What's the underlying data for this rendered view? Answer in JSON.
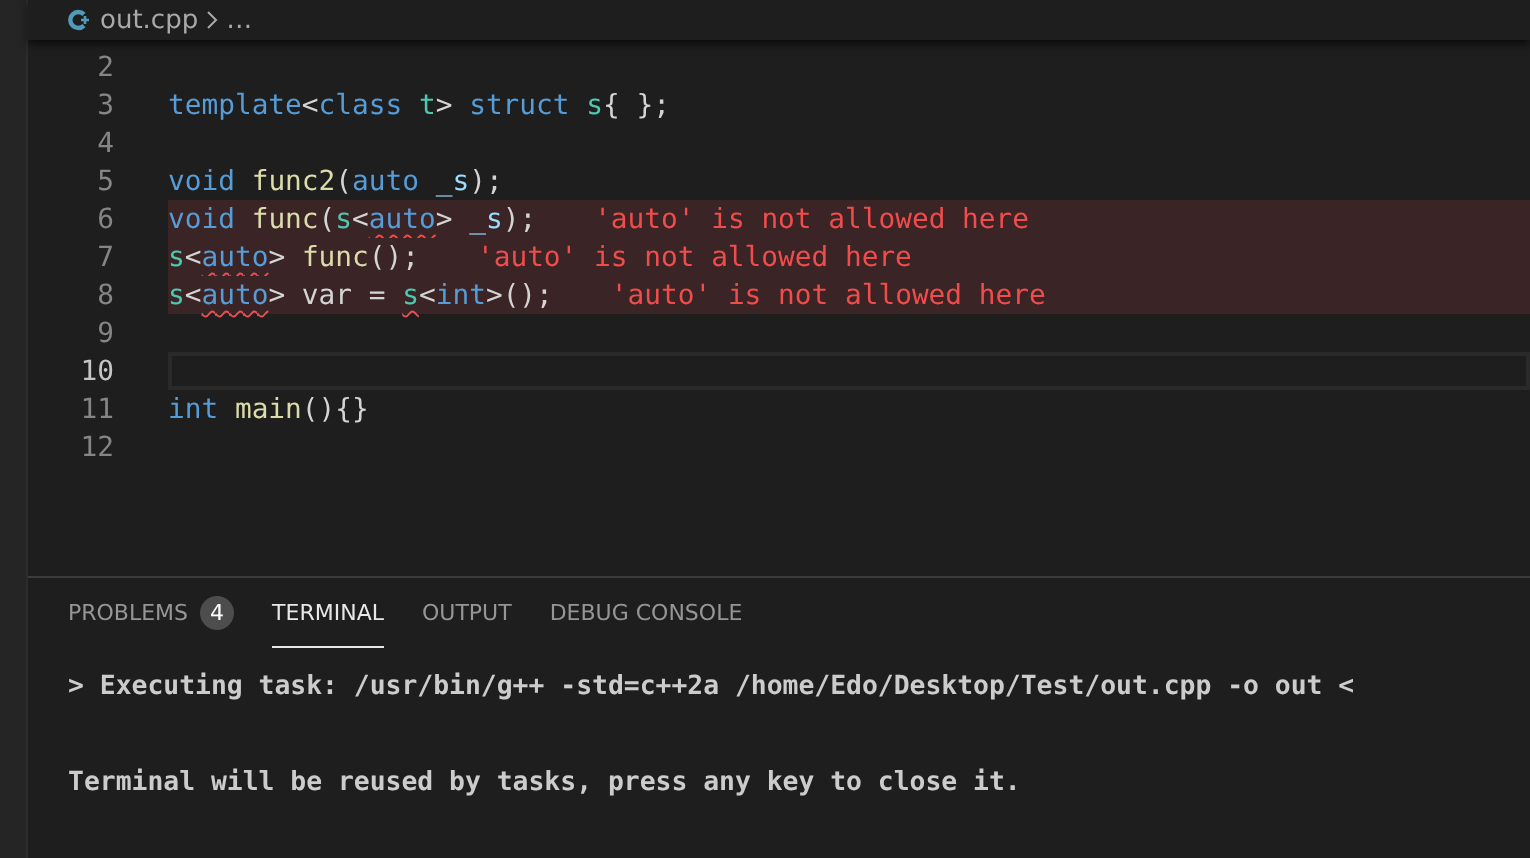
{
  "breadcrumb": {
    "file": "out.cpp",
    "separator": "…"
  },
  "editor": {
    "lines": [
      {
        "number": "2",
        "current": false
      },
      {
        "number": "3",
        "current": false,
        "tokens": [
          {
            "text": "template",
            "kind": "keyword"
          },
          {
            "text": "<",
            "kind": "plain"
          },
          {
            "text": "class ",
            "kind": "keyword"
          },
          {
            "text": "t",
            "kind": "type"
          },
          {
            "text": "> ",
            "kind": "plain"
          },
          {
            "text": "struct ",
            "kind": "keyword"
          },
          {
            "text": "s",
            "kind": "type"
          },
          {
            "text": "{ };",
            "kind": "plain"
          }
        ]
      },
      {
        "number": "4",
        "current": false
      },
      {
        "number": "5",
        "current": false,
        "tokens": [
          {
            "text": "void ",
            "kind": "keyword"
          },
          {
            "text": "func2",
            "kind": "func"
          },
          {
            "text": "(",
            "kind": "plain"
          },
          {
            "text": "auto ",
            "kind": "keyword"
          },
          {
            "text": "_s",
            "kind": "param"
          },
          {
            "text": ");",
            "kind": "plain"
          }
        ]
      },
      {
        "number": "6",
        "current": false,
        "error": "'auto' is not allowed here",
        "tokens": [
          {
            "text": "void ",
            "kind": "keyword"
          },
          {
            "text": "func",
            "kind": "func"
          },
          {
            "text": "(",
            "kind": "plain"
          },
          {
            "text": "s",
            "kind": "type"
          },
          {
            "text": "<",
            "kind": "plain"
          },
          {
            "text": "auto",
            "kind": "keyword",
            "squiggle": true
          },
          {
            "text": "> ",
            "kind": "plain"
          },
          {
            "text": "_s",
            "kind": "param"
          },
          {
            "text": ");",
            "kind": "plain"
          }
        ]
      },
      {
        "number": "7",
        "current": false,
        "error": "'auto' is not allowed here",
        "tokens": [
          {
            "text": "s",
            "kind": "type"
          },
          {
            "text": "<",
            "kind": "plain"
          },
          {
            "text": "auto",
            "kind": "keyword",
            "squiggle": true
          },
          {
            "text": "> ",
            "kind": "plain"
          },
          {
            "text": "func",
            "kind": "func"
          },
          {
            "text": "();",
            "kind": "plain"
          }
        ]
      },
      {
        "number": "8",
        "current": false,
        "error": "'auto' is not allowed here",
        "tokens": [
          {
            "text": "s",
            "kind": "type"
          },
          {
            "text": "<",
            "kind": "plain"
          },
          {
            "text": "auto",
            "kind": "keyword",
            "squiggle": true
          },
          {
            "text": "> var = ",
            "kind": "plain"
          },
          {
            "text": "s",
            "kind": "type",
            "squiggle": true
          },
          {
            "text": "<",
            "kind": "plain"
          },
          {
            "text": "int",
            "kind": "keyword"
          },
          {
            "text": ">();",
            "kind": "plain"
          }
        ]
      },
      {
        "number": "9",
        "current": false
      },
      {
        "number": "10",
        "current": true
      },
      {
        "number": "11",
        "current": false,
        "tokens": [
          {
            "text": "int ",
            "kind": "keyword"
          },
          {
            "text": "main",
            "kind": "func"
          },
          {
            "text": "(){}",
            "kind": "plain"
          }
        ]
      },
      {
        "number": "12",
        "current": false
      }
    ]
  },
  "panel": {
    "tabs": [
      {
        "label": "PROBLEMS",
        "badge": "4",
        "selected": false
      },
      {
        "label": "TERMINAL",
        "selected": true
      },
      {
        "label": "OUTPUT",
        "selected": false
      },
      {
        "label": "DEBUG CONSOLE",
        "selected": false
      }
    ],
    "terminal": [
      "> Executing task: /usr/bin/g++ -std=c++2a /home/Edo/Desktop/Test/out.cpp -o out <",
      "Terminal will be reused by tasks, press any key to close it."
    ]
  }
}
